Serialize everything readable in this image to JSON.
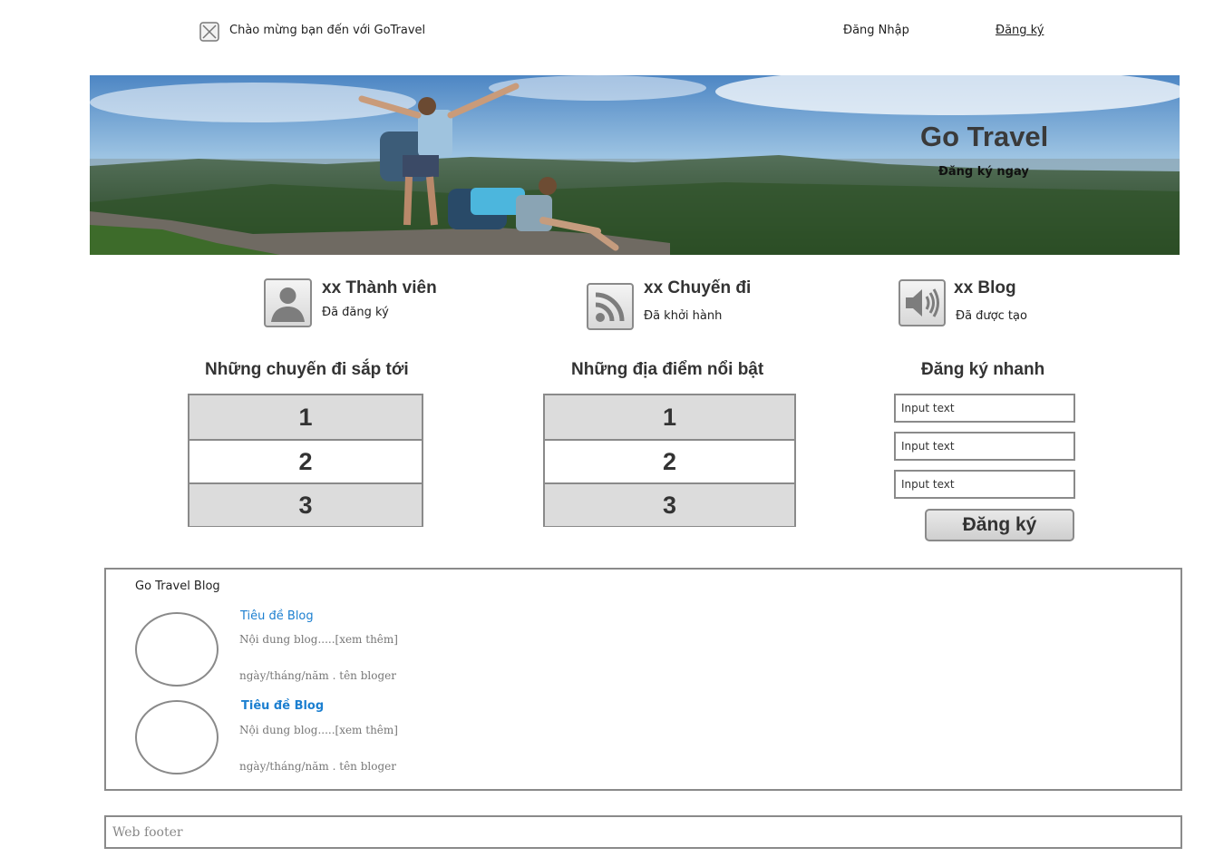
{
  "topbar": {
    "logo_icon": "image-placeholder-icon",
    "welcome": "Chào mừng bạn đến với GoTravel",
    "login": "Đăng Nhập",
    "register": "Đăng ký"
  },
  "banner": {
    "title": "Go Travel",
    "cta": "Đăng ký ngay"
  },
  "stats": [
    {
      "icon": "user-icon",
      "title": "xx Thành viên",
      "subtitle": "Đã đăng ký"
    },
    {
      "icon": "rss-icon",
      "title": "xx Chuyến đi",
      "subtitle": "Đã khởi hành"
    },
    {
      "icon": "speaker-icon",
      "title": "xx Blog",
      "subtitle": "Đã được tạo"
    }
  ],
  "upcoming_trips": {
    "heading": "Những chuyến đi sắp tới",
    "items": [
      "1",
      "2",
      "3"
    ]
  },
  "featured_places": {
    "heading": "Những địa điểm nổi bật",
    "items": [
      "1",
      "2",
      "3"
    ]
  },
  "quick_register": {
    "heading": "Đăng ký nhanh",
    "inputs": [
      "Input text",
      "Input text",
      "Input text"
    ],
    "button": "Đăng ký"
  },
  "blog": {
    "heading": "Go Travel Blog",
    "posts": [
      {
        "title": "Tiêu đề Blog",
        "excerpt": "Nội dung blog.....[xem thêm]",
        "meta": "ngày/tháng/năm . tên bloger"
      },
      {
        "title": "Tiêu đề Blog",
        "excerpt": "Nội dung blog.....[xem thêm]",
        "meta": "ngày/tháng/năm . tên bloger"
      }
    ]
  },
  "footer": "Web footer",
  "colors": {
    "accent_link": "#1c7fd0",
    "border": "#8a8a8a",
    "row_shade": "#dcdcdc"
  }
}
